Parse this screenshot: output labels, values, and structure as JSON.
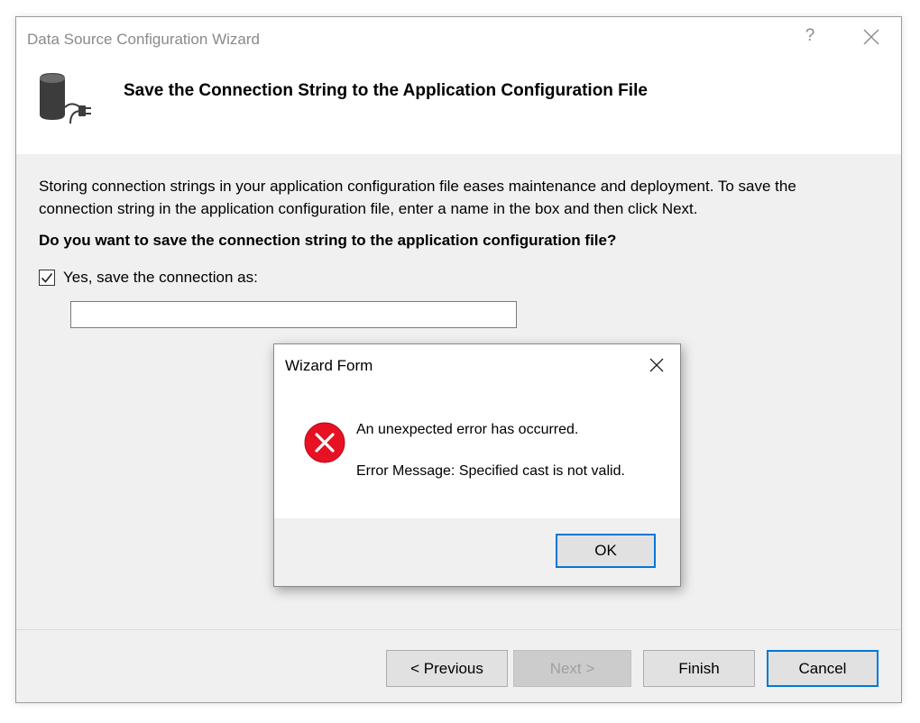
{
  "window": {
    "title": "Data Source Configuration Wizard",
    "help_glyph": "?"
  },
  "header": {
    "title": "Save the Connection String to the Application Configuration File",
    "icon": "database-connection-icon"
  },
  "content": {
    "description": "Storing connection strings in your application configuration file eases maintenance and deployment. To save the connection string in the application configuration file, enter a name in the box and then click Next.",
    "question": "Do you want to save the connection string to the application configuration file?",
    "save_checkbox": {
      "label": "Yes, save the connection as:",
      "checked": true
    },
    "connection_name": {
      "value": "",
      "placeholder": ""
    }
  },
  "footer": {
    "previous_label": "< Previous",
    "next_label": "Next >",
    "finish_label": "Finish",
    "cancel_label": "Cancel"
  },
  "dialog": {
    "title": "Wizard Form",
    "icon": "error-icon",
    "message": "An unexpected error has occurred.",
    "error_message": "Error Message: Specified cast is not valid.",
    "ok_label": "OK"
  },
  "colors": {
    "accent": "#0078d7",
    "error_red": "#e81123",
    "dialog_background": "#f0f0f0"
  }
}
